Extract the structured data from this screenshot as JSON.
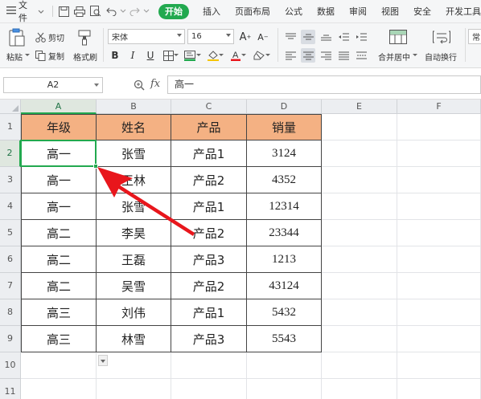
{
  "menubar": {
    "file_label": "文件",
    "tabs": [
      "开始",
      "插入",
      "页面布局",
      "公式",
      "数据",
      "审阅",
      "视图",
      "安全",
      "开发工具"
    ],
    "active_tab_index": 0
  },
  "ribbon": {
    "paste_label": "粘贴",
    "cut_label": "剪切",
    "copy_label": "复制",
    "format_painter_label": "格式刷",
    "font_name": "宋体",
    "font_size": "16",
    "bold": "B",
    "italic": "I",
    "underline": "U",
    "merge_center_label": "合并居中",
    "wrap_text_label": "自动换行",
    "partial_next": "常"
  },
  "formula_bar": {
    "cell_ref": "A2",
    "fx_label": "fx",
    "content": "高一"
  },
  "sheet": {
    "columns": [
      "A",
      "B",
      "C",
      "D",
      "E",
      "F"
    ],
    "rows": [
      "1",
      "2",
      "3",
      "4",
      "5",
      "6",
      "7",
      "8",
      "9",
      "10",
      "11"
    ],
    "selected_cell": "A2",
    "header_fill": "#F4B183",
    "selection_color": "#22A94F",
    "arrow_color": "#E8161C",
    "table": {
      "headers": [
        "年级",
        "姓名",
        "产品",
        "销量"
      ],
      "rows": [
        [
          "高一",
          "张雪",
          "产品1",
          "3124"
        ],
        [
          "高一",
          "王林",
          "产品2",
          "4352"
        ],
        [
          "高一",
          "张雪",
          "产品1",
          "12314"
        ],
        [
          "高二",
          "李昊",
          "产品2",
          "23344"
        ],
        [
          "高二",
          "王磊",
          "产品3",
          "1213"
        ],
        [
          "高二",
          "吴雪",
          "产品2",
          "43124"
        ],
        [
          "高三",
          "刘伟",
          "产品1",
          "5432"
        ],
        [
          "高三",
          "林雪",
          "产品3",
          "5543"
        ]
      ]
    }
  }
}
